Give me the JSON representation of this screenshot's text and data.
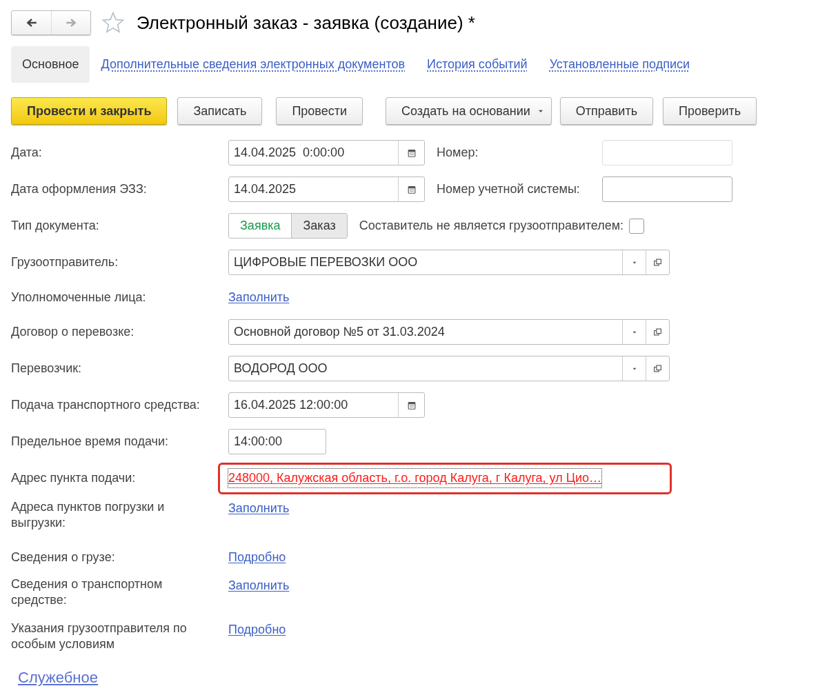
{
  "window": {
    "title": "Электронный заказ - заявка (создание) *",
    "favorite": false
  },
  "tabs": [
    {
      "label": "Основное",
      "selected": true
    },
    {
      "label": "Дополнительные сведения электронных документов",
      "selected": false
    },
    {
      "label": "История событий",
      "selected": false
    },
    {
      "label": "Установленные подписи",
      "selected": false
    }
  ],
  "toolbar": [
    {
      "label": "Провести и закрыть",
      "kind": "primary"
    },
    {
      "label": "Записать",
      "kind": "plain"
    },
    {
      "label": "Провести",
      "kind": "plain"
    },
    {
      "label": "Создать на основании",
      "kind": "menu"
    },
    {
      "label": "Отправить",
      "kind": "plain"
    },
    {
      "label": "Проверить",
      "kind": "plain"
    }
  ],
  "fields": [
    {
      "label": "Дата:",
      "kind": "date",
      "value": "14.04.2025  0:00:00",
      "extra": {
        "label": "Номер:",
        "disabled": true
      }
    },
    {
      "label": "Дата оформления ЭЗЗ:",
      "kind": "date",
      "value": "14.04.2025",
      "extra": {
        "label": "Номер учетной системы:",
        "disabled": false
      }
    },
    {
      "label": "Тип документа:",
      "kind": "toggle",
      "options": [
        {
          "label": "Заявка",
          "selected": true
        },
        {
          "label": "Заказ",
          "selected": false
        }
      ],
      "checkbox": {
        "label": "Составитель не является грузоотправителем:",
        "checked": false
      }
    },
    {
      "label": "Грузоотправитель:",
      "kind": "select",
      "value": "ЦИФРОВЫЕ ПЕРЕВОЗКИ ООО"
    },
    {
      "label": "Уполномоченные лица:",
      "kind": "link",
      "value": "Заполнить"
    },
    {
      "label": "Договор о перевозке:",
      "kind": "select",
      "value": "Основной договор №5 от 31.03.2024"
    },
    {
      "label": "Перевозчик:",
      "kind": "select",
      "value": "ВОДОРОД ООО"
    },
    {
      "label": "Подача транспортного средства:",
      "kind": "date",
      "value": "16.04.2025 12:00:00"
    },
    {
      "label": "Предельное время подачи:",
      "kind": "time",
      "value": "14:00:00"
    },
    {
      "label": "Адрес пункта подачи:",
      "kind": "address",
      "value": "248000, Калужская область, г.о. город Калуга, г Калуга, ул Цио…",
      "highlighted": true
    },
    {
      "label": "Адреса пунктов погрузки и выгрузки:",
      "kind": "link",
      "value": "Заполнить"
    },
    {
      "label": "Сведения о грузе:",
      "kind": "link",
      "value": "Подробно"
    },
    {
      "label": "Сведения о транспортном средстве:",
      "kind": "link",
      "value": "Заполнить"
    },
    {
      "label": "Указания грузоотправителя по особым условиям",
      "kind": "link",
      "value": "Подробно"
    }
  ],
  "footer_link": "Служебное"
}
